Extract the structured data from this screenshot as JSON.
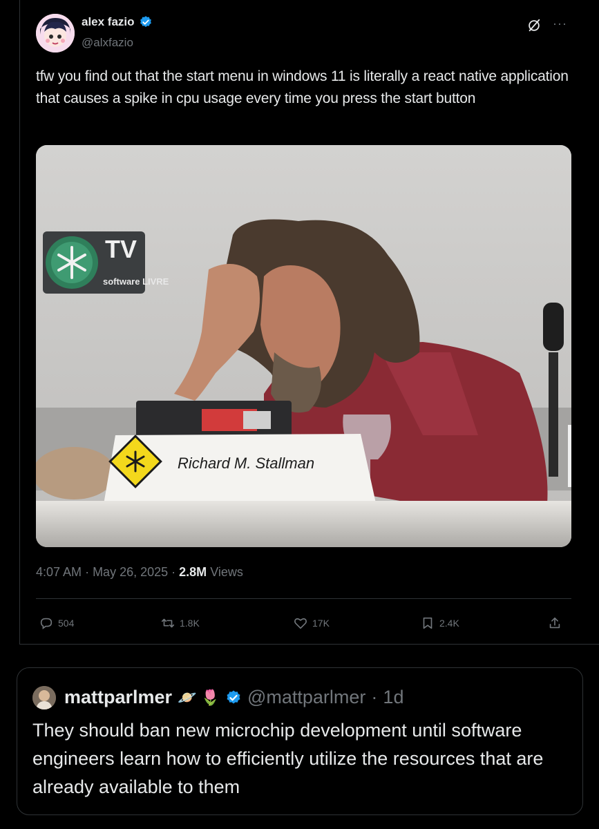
{
  "tweet": {
    "author_name": "alex fazio",
    "author_handle": "@alxfazio",
    "text": "tfw you find out that the start menu in windows 11 is literally a react native application that causes a spike in cpu usage every time you press the start button",
    "media": {
      "tv_logo_text": "TV",
      "tv_logo_sub": "software LIVRE",
      "name_card": "Richard M. Stallman"
    },
    "time": "4:07 AM",
    "date": "May 26, 2025",
    "views_count": "2.8M",
    "views_label": "Views",
    "actions": {
      "replies": "504",
      "reposts": "1.8K",
      "likes": "17K",
      "bookmarks": "2.4K"
    }
  },
  "quote": {
    "author_name": "mattparlmer",
    "emojis": "🪐 🌷",
    "handle": "@mattparlmer",
    "age": "1d",
    "text": "They should ban new microchip development until software engineers learn how to efficiently utilize the resources that are already available to them"
  },
  "colors": {
    "background": "#000000",
    "text": "#e7e9ea",
    "muted": "#71767b",
    "verified": "#1d9bf0",
    "border": "#2f3336"
  }
}
